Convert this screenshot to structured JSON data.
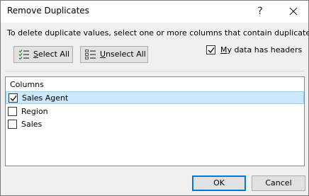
{
  "window": {
    "title": "Remove Duplicates",
    "help_label": "?",
    "close_icon": "close-icon"
  },
  "instruction": "To delete duplicate values, select one or more columns that contain duplicates.",
  "toolbar": {
    "select_all": {
      "prefix": "",
      "accel": "S",
      "rest": "elect All",
      "icon": "select-all-icon"
    },
    "unselect_all": {
      "prefix": "",
      "accel": "U",
      "rest": "nselect All",
      "icon": "unselect-all-icon"
    }
  },
  "headers_option": {
    "prefix": "",
    "accel": "M",
    "rest": "y data has headers",
    "checked": true
  },
  "columns": {
    "header": "Columns",
    "items": [
      {
        "label": "Sales Agent",
        "checked": true,
        "selected": true
      },
      {
        "label": "Region",
        "checked": false,
        "selected": false
      },
      {
        "label": "Sales",
        "checked": false,
        "selected": false
      }
    ]
  },
  "footer": {
    "ok_label": "OK",
    "cancel_label": "Cancel"
  },
  "colors": {
    "selection": "#cce8ff",
    "accent": "#0078d7"
  }
}
